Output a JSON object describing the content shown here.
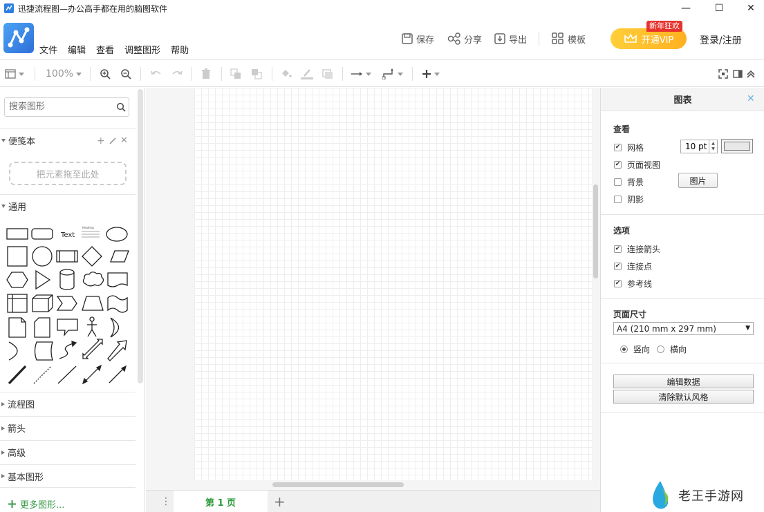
{
  "window": {
    "title": "迅捷流程图—办公高手都在用的脑图软件",
    "min_glyph": "—",
    "max_glyph": "☐",
    "close_glyph": "✕"
  },
  "menu": {
    "items": [
      "文件",
      "编辑",
      "查看",
      "调整图形",
      "帮助"
    ]
  },
  "header": {
    "save_label": "保存",
    "share_label": "分享",
    "export_label": "导出",
    "template_label": "模板",
    "vip_label": "开通VIP",
    "vip_badge": "新年狂欢",
    "login_label": "登录/注册"
  },
  "toolbar": {
    "zoom": "100%"
  },
  "sidebar": {
    "search_placeholder": "搜索图形",
    "scratchpad_title": "便笺本",
    "scratchpad_drop": "把元素拖至此处",
    "general_title": "通用",
    "shape_text_label": "Text",
    "shape_heading_label": "Heading",
    "collapsed_sections": [
      "流程图",
      "箭头",
      "高级",
      "基本图形"
    ],
    "more_shapes": "更多图形..."
  },
  "pages": {
    "menu_glyph": "⋮",
    "active_tab": "第 1 页",
    "add_glyph": "+"
  },
  "panel": {
    "title": "图表",
    "close_glyph": "✕",
    "view_section": "查看",
    "view_options": [
      {
        "label": "网格",
        "checked": true
      },
      {
        "label": "页面视图",
        "checked": true
      },
      {
        "label": "背景",
        "checked": false
      },
      {
        "label": "阴影",
        "checked": false
      }
    ],
    "grid_size": "10 pt",
    "image_button": "图片",
    "options_section": "选项",
    "options": [
      {
        "label": "连接箭头",
        "checked": true
      },
      {
        "label": "连接点",
        "checked": true
      },
      {
        "label": "参考线",
        "checked": true
      }
    ],
    "page_size_section": "页面尺寸",
    "page_size_value": "A4 (210 mm x 297 mm)",
    "orientation_portrait": "竖向",
    "orientation_landscape": "横向",
    "edit_data_button": "编辑数据",
    "clear_style_button": "清除默认风格"
  },
  "watermark": {
    "text": "老王手游网"
  }
}
